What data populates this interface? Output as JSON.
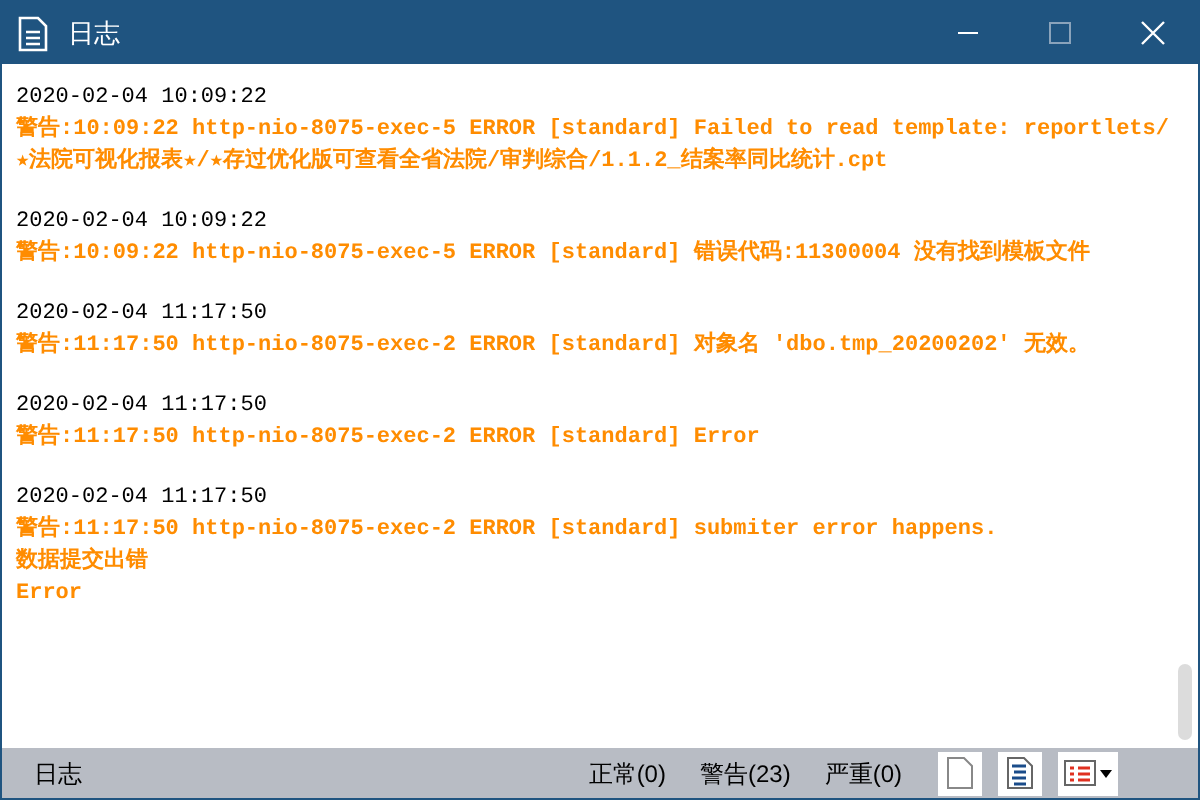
{
  "window": {
    "title": "日志"
  },
  "entries": [
    {
      "time": "2020-02-04 10:09:22",
      "lines": [
        "警告:10:09:22 http-nio-8075-exec-5 ERROR [standard] Failed to read template: reportlets/★法院可视化报表★/★存过优化版可查看全省法院/审判综合/1.1.2_结案率同比统计.cpt"
      ]
    },
    {
      "time": "2020-02-04 10:09:22",
      "lines": [
        "警告:10:09:22 http-nio-8075-exec-5 ERROR [standard] 错误代码:11300004 没有找到模板文件"
      ]
    },
    {
      "time": "2020-02-04 11:17:50",
      "lines": [
        "警告:11:17:50 http-nio-8075-exec-2 ERROR [standard] 对象名 'dbo.tmp_20200202' 无效。"
      ]
    },
    {
      "time": "2020-02-04 11:17:50",
      "lines": [
        "警告:11:17:50 http-nio-8075-exec-2 ERROR [standard] Error"
      ]
    },
    {
      "time": "2020-02-04 11:17:50",
      "lines": [
        "警告:11:17:50 http-nio-8075-exec-2 ERROR [standard] submiter error happens.",
        "数据提交出错",
        "Error"
      ]
    }
  ],
  "status_bar": {
    "label": "日志",
    "counts": [
      "正常(0)",
      "警告(23)",
      "严重(0)"
    ]
  }
}
